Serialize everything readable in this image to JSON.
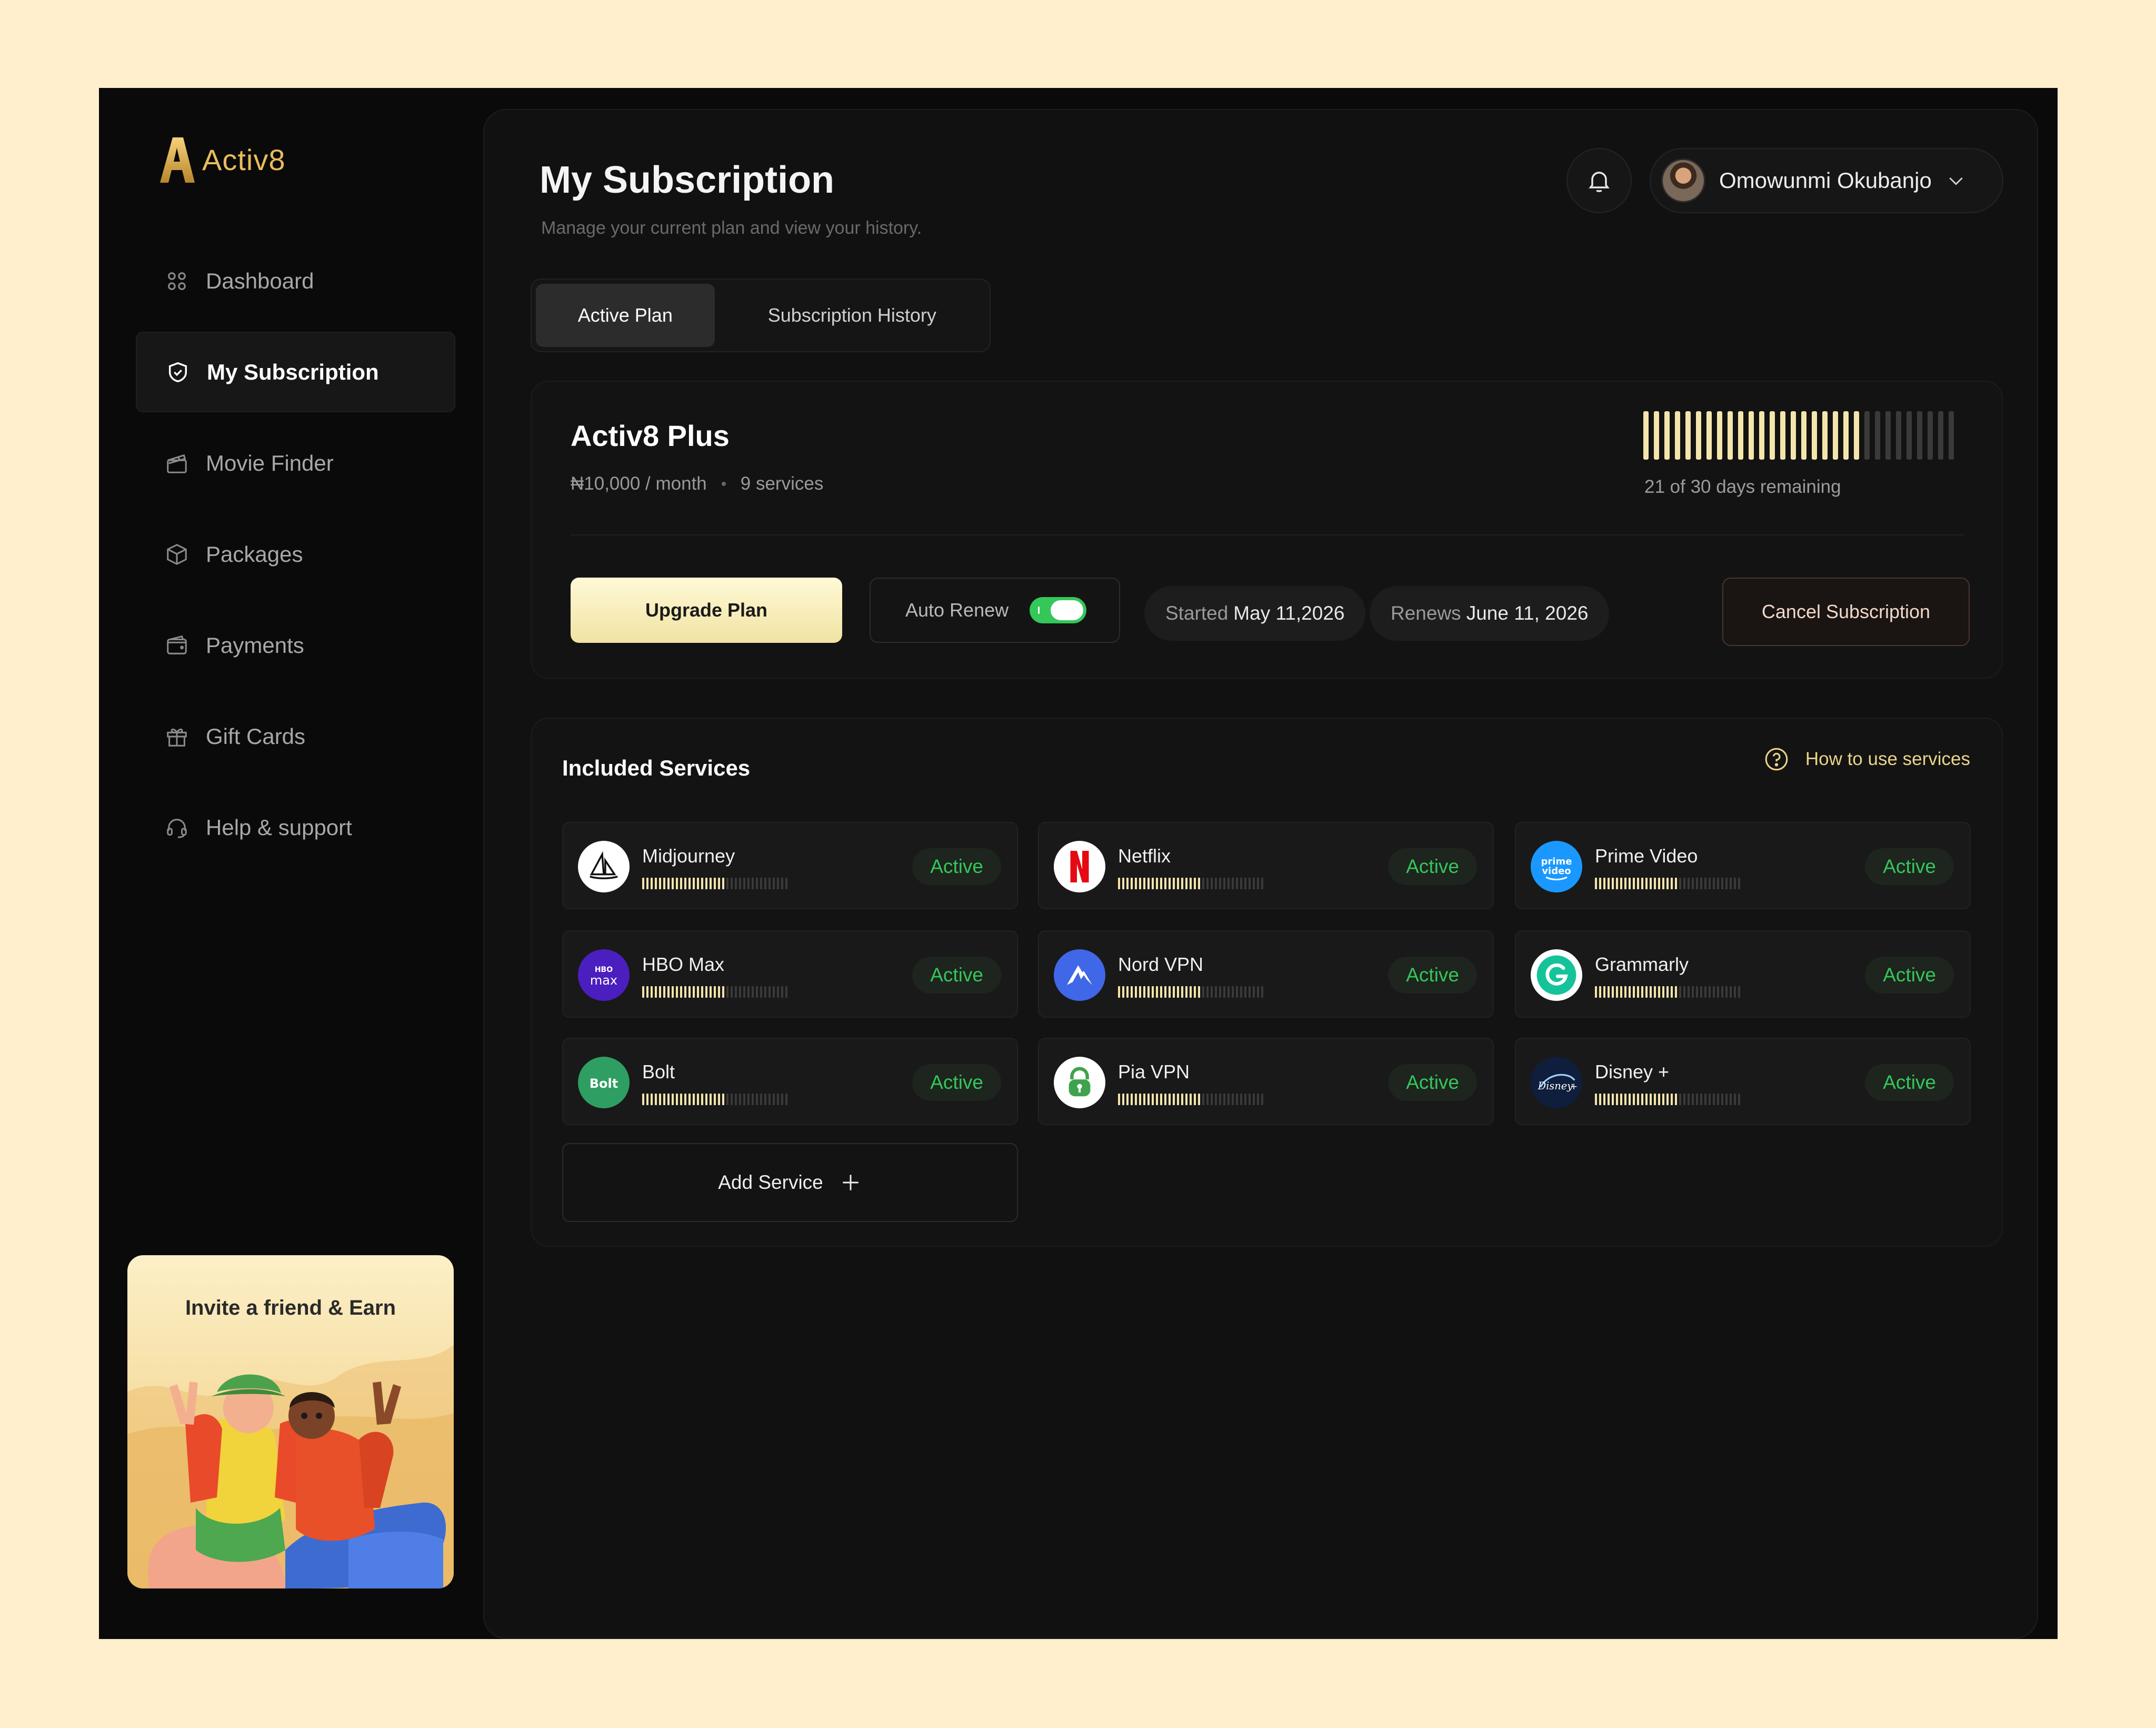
{
  "app": {
    "brand": "Activ8"
  },
  "sidebar": {
    "items": [
      {
        "label": "Dashboard",
        "icon": "grid-icon",
        "active": false
      },
      {
        "label": "My Subscription",
        "icon": "shield-check-icon",
        "active": true
      },
      {
        "label": "Movie Finder",
        "icon": "clapperboard-icon",
        "active": false
      },
      {
        "label": "Packages",
        "icon": "box-icon",
        "active": false
      },
      {
        "label": "Payments",
        "icon": "wallet-icon",
        "active": false
      },
      {
        "label": "Gift Cards",
        "icon": "gift-icon",
        "active": false
      },
      {
        "label": "Help & support",
        "icon": "headset-icon",
        "active": false
      }
    ],
    "promo": {
      "title": "Invite a friend & Earn"
    }
  },
  "header": {
    "title": "My Subscription",
    "subtitle": "Manage your current plan and view your history.",
    "user_name": "Omowunmi Okubanjo"
  },
  "tabs": [
    {
      "label": "Active Plan",
      "active": true
    },
    {
      "label": "Subscription History",
      "active": false
    }
  ],
  "plan": {
    "name": "Activ8 Plus",
    "price": "₦10,000 / month",
    "services_count": "9 services",
    "days_remaining_text": "21 of 30 days remaining",
    "days_remaining": 21,
    "days_total": 30,
    "upgrade_label": "Upgrade Plan",
    "auto_renew_label": "Auto Renew",
    "auto_renew_on": true,
    "started_label": "Started",
    "started_date": "May 11,2026",
    "renews_label": "Renews",
    "renews_date": "June 11, 2026",
    "cancel_label": "Cancel Subscription"
  },
  "services": {
    "title": "Included Services",
    "help_link": "How to use services",
    "add_label": "Add Service",
    "items": [
      {
        "name": "Midjourney",
        "status": "Active",
        "usage_fraction": 0.56
      },
      {
        "name": "Netflix",
        "status": "Active",
        "usage_fraction": 0.56
      },
      {
        "name": "Prime Video",
        "status": "Active",
        "usage_fraction": 0.56
      },
      {
        "name": "HBO Max",
        "status": "Active",
        "usage_fraction": 0.56
      },
      {
        "name": "Nord VPN",
        "status": "Active",
        "usage_fraction": 0.56
      },
      {
        "name": "Grammarly",
        "status": "Active",
        "usage_fraction": 0.56
      },
      {
        "name": "Bolt",
        "status": "Active",
        "usage_fraction": 0.56
      },
      {
        "name": "Pia VPN",
        "status": "Active",
        "usage_fraction": 0.56
      },
      {
        "name": "Disney +",
        "status": "Active",
        "usage_fraction": 0.56
      }
    ]
  },
  "colors": {
    "background": "#FFEFCD",
    "app_bg": "#0A0A0A",
    "panel": "#111111",
    "accent_gold": "#E9BC5C",
    "bar_on": "#F4E5AC",
    "active_green": "#34C759"
  }
}
